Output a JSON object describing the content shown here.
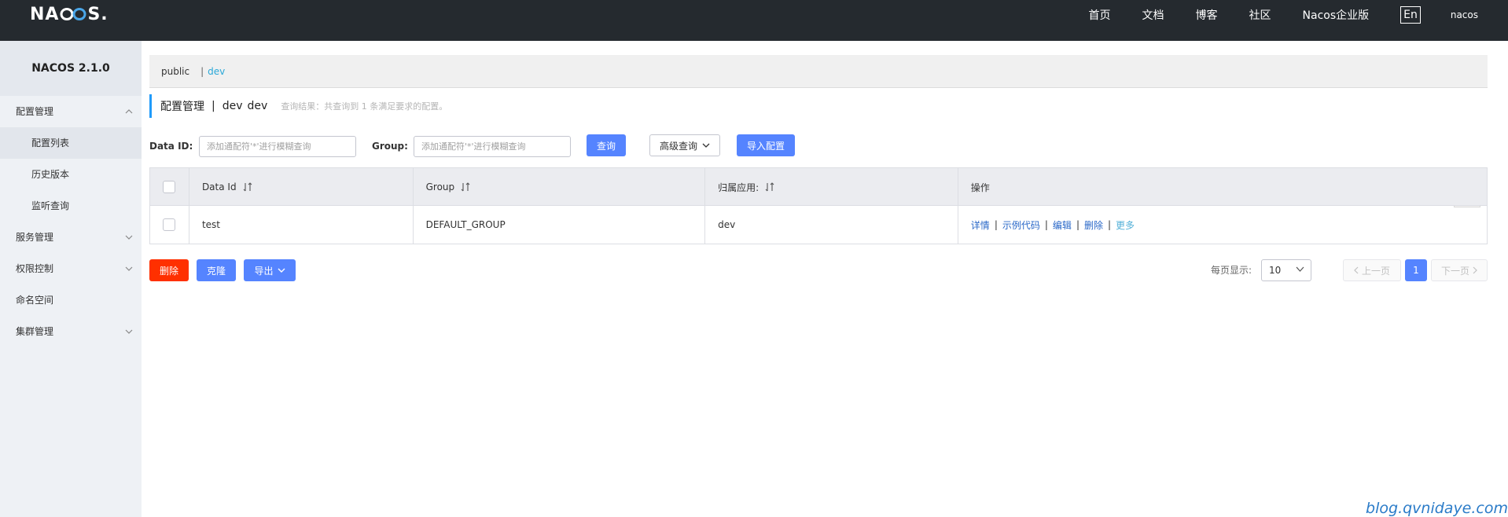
{
  "header": {
    "logo": {
      "prefix": "NA",
      "suffix": "S."
    },
    "nav": [
      "首页",
      "文档",
      "博客",
      "社区",
      "Nacos企业版"
    ],
    "lang": "En",
    "user": "nacos"
  },
  "sidebar": {
    "brand": "NACOS 2.1.0",
    "config_group": "配置管理",
    "config_items": [
      "配置列表",
      "历史版本",
      "监听查询"
    ],
    "groups": [
      "服务管理",
      "权限控制",
      "命名空间",
      "集群管理"
    ]
  },
  "namespaces": {
    "public": "public",
    "separator": "|",
    "dev": "dev"
  },
  "title": {
    "main": "配置管理",
    "separator": "|",
    "ns_name": "dev",
    "ns_id": "dev",
    "result": "查询结果：共查询到 1 条满足要求的配置。"
  },
  "filter": {
    "data_id_label": "Data ID:",
    "data_id_placeholder": "添加通配符'*'进行模糊查询",
    "group_label": "Group:",
    "group_placeholder": "添加通配符'*'进行模糊查询",
    "search": "查询",
    "advanced": "高级查询",
    "import": "导入配置"
  },
  "table": {
    "headers": [
      "Data Id",
      "Group",
      "归属应用:",
      "操作"
    ],
    "rows": [
      {
        "data_id": "test",
        "group": "DEFAULT_GROUP",
        "app": "dev"
      }
    ],
    "ops": [
      "详情",
      "示例代码",
      "编辑",
      "删除",
      "更多"
    ]
  },
  "actions": {
    "delete": "删除",
    "clone": "克隆",
    "export": "导出"
  },
  "pagination": {
    "page_size_label": "每页显示:",
    "page_size": "10",
    "prev": "上一页",
    "current": "1",
    "next": "下一页"
  },
  "watermark": "blog.qvnidaye.com",
  "colors": {
    "topbar": "#252a2f",
    "primary": "#5584ff",
    "danger": "#ff3000",
    "link": "#2a68c8",
    "sidebar": "#eef1f5"
  }
}
